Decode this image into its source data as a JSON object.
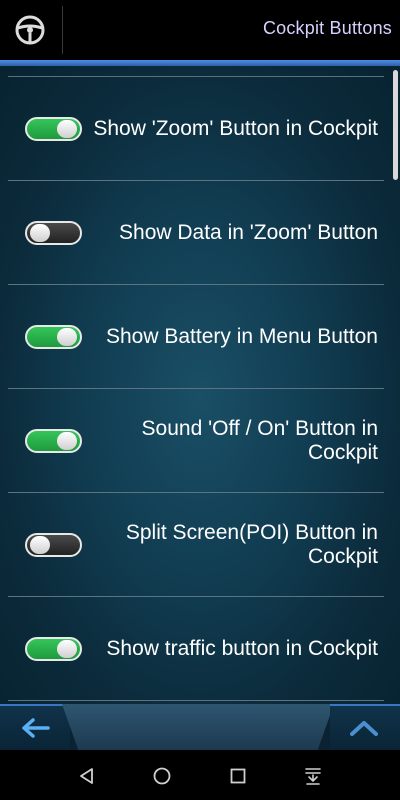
{
  "header": {
    "title": "Cockpit Buttons",
    "logo_icon": "steering-wheel-icon"
  },
  "settings": [
    {
      "label": "Show 'Zoom' Button in Cockpit",
      "enabled": true
    },
    {
      "label": "Show Data in 'Zoom' Button",
      "enabled": false
    },
    {
      "label": "Show Battery in Menu Button",
      "enabled": true
    },
    {
      "label": "Sound 'Off / On' Button in Cockpit",
      "enabled": true
    },
    {
      "label": "Split Screen(POI) Button in Cockpit",
      "enabled": false
    },
    {
      "label": "Show traffic button in Cockpit",
      "enabled": true
    }
  ],
  "bottom_bar": {
    "back_icon": "back-arrow-icon",
    "up_icon": "chevron-up-icon"
  },
  "nav_bar": {
    "icons": [
      "back-triangle-icon",
      "home-circle-icon",
      "recents-square-icon",
      "notifications-pull-icon"
    ]
  },
  "colors": {
    "accent_blue": "#3b76c4",
    "toggle_on": "#2fb84f",
    "toggle_off": "#333333",
    "title_text": "#d8d0ff"
  }
}
